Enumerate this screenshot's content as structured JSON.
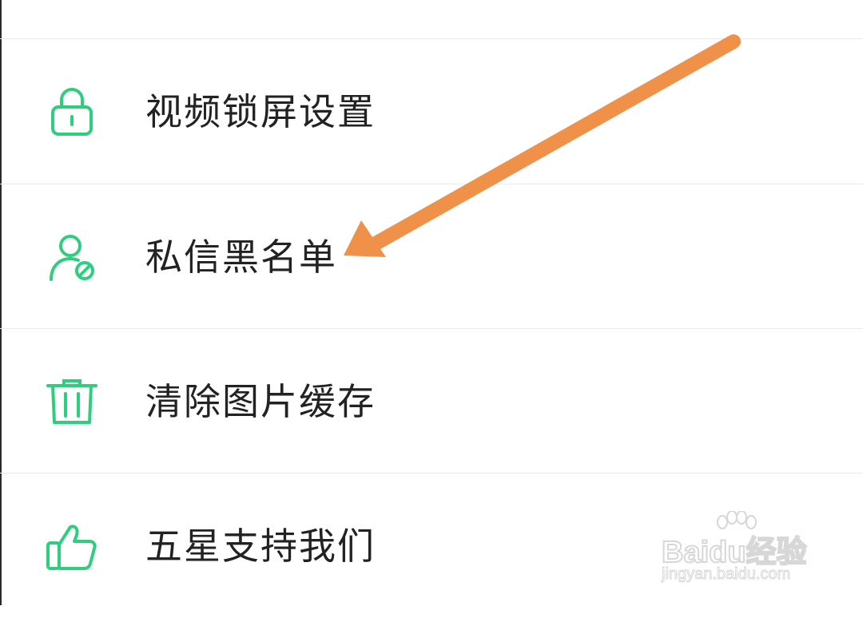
{
  "menu": {
    "items": [
      {
        "label": "视频锁屏设置",
        "icon": "lock-icon"
      },
      {
        "label": "私信黑名单",
        "icon": "user-blocked-icon"
      },
      {
        "label": "清除图片缓存",
        "icon": "trash-icon"
      },
      {
        "label": "五星支持我们",
        "icon": "thumbs-up-icon"
      }
    ]
  },
  "colors": {
    "icon_green": "#2fce7e",
    "text": "#222222",
    "divider": "#ebebeb",
    "annotation_arrow": "#f0914a"
  },
  "watermark": {
    "brand": "Baidu经验",
    "url": "jingyan.baidu.com"
  }
}
